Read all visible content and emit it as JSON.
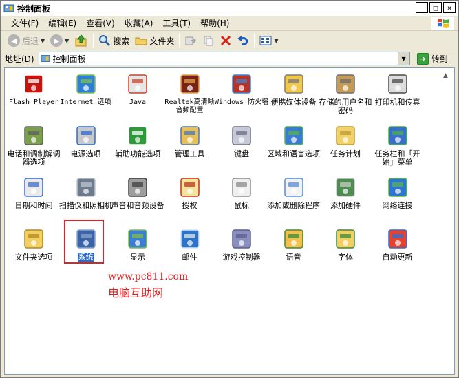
{
  "window": {
    "title": "控制面板"
  },
  "caption": {
    "minimize": "_",
    "maximize": "□",
    "close": "×"
  },
  "menu": [
    "文件(F)",
    "编辑(E)",
    "查看(V)",
    "收藏(A)",
    "工具(T)",
    "帮助(H)"
  ],
  "toolbar": {
    "back": "后退",
    "search": "搜索",
    "folders": "文件夹"
  },
  "address": {
    "label": "地址(D)",
    "value": "控制面板",
    "go": "转到"
  },
  "items": [
    {
      "label": "Flash Player",
      "icon": "flash-icon",
      "mono": true
    },
    {
      "label": "Internet 选项",
      "icon": "internet-options-icon",
      "mono": true
    },
    {
      "label": "Java",
      "icon": "java-icon",
      "mono": true
    },
    {
      "label": "Realtek高清晰音频配置",
      "icon": "speaker-icon",
      "mono": true
    },
    {
      "label": "Windows 防火墙",
      "icon": "firewall-icon",
      "mono": true
    },
    {
      "label": "便携媒体设备",
      "icon": "media-device-icon"
    },
    {
      "label": "存储的用户名和密码",
      "icon": "credentials-icon"
    },
    {
      "label": "打印机和传真",
      "icon": "printer-icon"
    },
    {
      "label": "电话和调制解调器选项",
      "icon": "phone-icon"
    },
    {
      "label": "电源选项",
      "icon": "power-icon"
    },
    {
      "label": "辅助功能选项",
      "icon": "accessibility-icon"
    },
    {
      "label": "管理工具",
      "icon": "admin-tools-icon"
    },
    {
      "label": "键盘",
      "icon": "keyboard-icon"
    },
    {
      "label": "区域和语言选项",
      "icon": "globe-icon"
    },
    {
      "label": "任务计划",
      "icon": "scheduled-tasks-icon"
    },
    {
      "label": "任务栏和「开始」菜单",
      "icon": "taskbar-icon"
    },
    {
      "label": "日期和时间",
      "icon": "datetime-icon"
    },
    {
      "label": "扫描仪和照相机",
      "icon": "scanner-icon"
    },
    {
      "label": "声音和音频设备",
      "icon": "sound-icon"
    },
    {
      "label": "授权",
      "icon": "license-icon"
    },
    {
      "label": "鼠标",
      "icon": "mouse-icon"
    },
    {
      "label": "添加或删除程序",
      "icon": "add-remove-icon"
    },
    {
      "label": "添加硬件",
      "icon": "add-hardware-icon"
    },
    {
      "label": "网络连接",
      "icon": "network-icon"
    },
    {
      "label": "文件夹选项",
      "icon": "folder-options-icon"
    },
    {
      "label": "系统",
      "icon": "system-icon",
      "selected": true
    },
    {
      "label": "显示",
      "icon": "display-icon"
    },
    {
      "label": "邮件",
      "icon": "mail-icon"
    },
    {
      "label": "游戏控制器",
      "icon": "gamepad-icon"
    },
    {
      "label": "语音",
      "icon": "speech-icon"
    },
    {
      "label": "字体",
      "icon": "fonts-icon"
    },
    {
      "label": "自动更新",
      "icon": "windows-update-icon"
    }
  ],
  "watermark": {
    "url": "www.pc811.com",
    "name": "电脑互助网"
  },
  "colors": {
    "selection": "#316ac5",
    "highlight_box": "#d3272d",
    "watermark": "#e02020"
  }
}
